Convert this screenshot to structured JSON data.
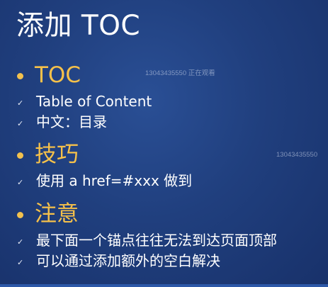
{
  "slide": {
    "title": "添加 TOC",
    "sections": [
      {
        "heading": "TOC",
        "items": [
          "Table of Content",
          "中文：目录"
        ]
      },
      {
        "heading": "技巧",
        "items": [
          "使用 a href=#xxx 做到"
        ]
      },
      {
        "heading": "注意",
        "items": [
          "最下面一个锚点往往无法到达页面顶部",
          "可以通过添加额外的空白解决"
        ]
      }
    ],
    "check_glyph": "✓"
  },
  "watermarks": {
    "viewer": "13043435550 正在观看",
    "id_right": "13043435550"
  },
  "colors": {
    "background": "#203f7e",
    "accent": "#f6c14a"
  }
}
